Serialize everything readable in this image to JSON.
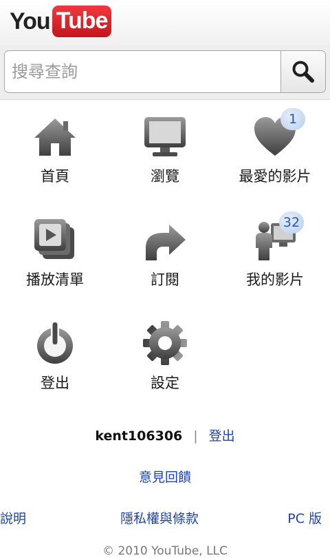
{
  "header": {
    "logo_you": "You",
    "logo_tube": "Tube"
  },
  "search": {
    "placeholder": "搜尋查詢",
    "value": ""
  },
  "menu": [
    {
      "label": "首頁",
      "icon": "home-icon"
    },
    {
      "label": "瀏覽",
      "icon": "monitor-icon"
    },
    {
      "label": "最愛的影片",
      "icon": "heart-icon",
      "badge": "1"
    },
    {
      "label": "播放清單",
      "icon": "playlist-icon"
    },
    {
      "label": "訂閱",
      "icon": "subscribe-arrow-icon"
    },
    {
      "label": "我的影片",
      "icon": "user-video-icon",
      "badge": "32"
    },
    {
      "label": "登出",
      "icon": "power-icon"
    },
    {
      "label": "設定",
      "icon": "gear-icon"
    }
  ],
  "account": {
    "username": "kent106306",
    "separator": "|",
    "logout_label": "登出"
  },
  "feedback_label": "意見回饋",
  "footer": {
    "help": "說明",
    "privacy": "隱私權與條款",
    "pc": "PC 版"
  },
  "copyright": "© 2010 YouTube, LLC",
  "colors": {
    "brand_red": "#e62117",
    "link_blue": "#1c43b0",
    "badge_text": "#2d55a8",
    "icon_gray": "#5a5a5a"
  }
}
